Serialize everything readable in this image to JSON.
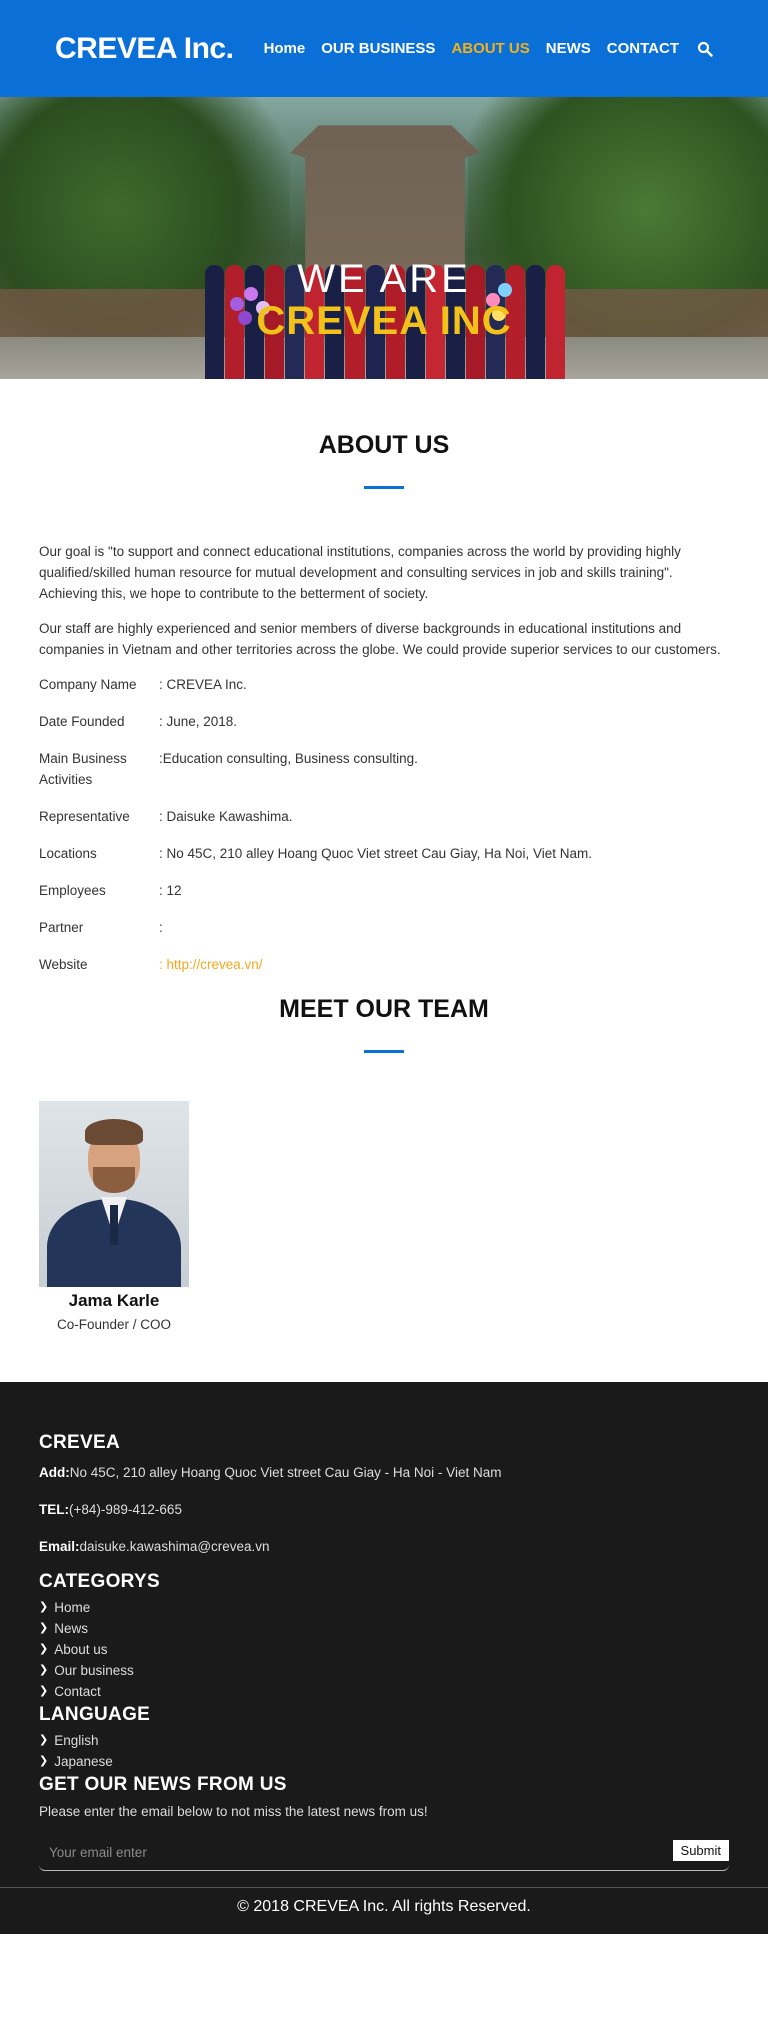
{
  "header": {
    "logo": "CREVEA Inc.",
    "nav": [
      {
        "label": "Home",
        "active": false
      },
      {
        "label": "OUR BUSINESS",
        "active": false
      },
      {
        "label": "ABOUT US",
        "active": true
      },
      {
        "label": "NEWS",
        "active": false
      },
      {
        "label": "CONTACT",
        "active": false
      }
    ],
    "search_icon": "search-icon"
  },
  "hero": {
    "line1": "WE ARE",
    "line2": "CREVEA INC"
  },
  "about": {
    "title": "ABOUT US",
    "paragraphs": [
      "Our goal is \"to support and connect educational institutions, companies across the world by providing highly qualified/skilled human resource for mutual development and consulting services in job and skills training\". Achieving this, we hope to contribute to the betterment of society.",
      "Our staff are highly experienced and senior members of diverse backgrounds in educational institutions and companies in Vietnam and other territories across the globe. We could provide superior services to our customers."
    ],
    "info": [
      {
        "key": "Company Name",
        "value": ": CREVEA Inc."
      },
      {
        "key": "Date Founded",
        "value": ": June, 2018."
      },
      {
        "key": "Main Business Activities",
        "value": ":Education consulting, Business consulting."
      },
      {
        "key": "Representative",
        "value": ": Daisuke Kawashima."
      },
      {
        "key": "Locations",
        "value": ": No 45C, 210 alley Hoang Quoc Viet street Cau Giay, Ha Noi, Viet Nam."
      },
      {
        "key": "Employees",
        "value": ": 12"
      },
      {
        "key": "Partner",
        "value": ":"
      },
      {
        "key": "Website",
        "value": ": http://crevea.vn/"
      }
    ]
  },
  "team": {
    "title": "MEET OUR TEAM",
    "members": [
      {
        "name": "Jama Karle",
        "role": "Co-Founder / COO"
      }
    ]
  },
  "footer": {
    "company_heading": "CREVEA",
    "address_label": "Add:",
    "address": "No 45C, 210 alley Hoang Quoc Viet street Cau Giay - Ha Noi - Viet Nam",
    "tel_label": "TEL:",
    "tel": "(+84)-989-412-665",
    "email_label": "Email:",
    "email": "daisuke.kawashima@crevea.vn",
    "categories_heading": "CATEGORYS",
    "categories": [
      "Home",
      "News",
      "About us",
      "Our business",
      "Contact"
    ],
    "language_heading": "LANGUAGE",
    "languages": [
      "English",
      "Japanese"
    ],
    "news_heading": "GET OUR NEWS FROM US",
    "news_sub": "Please enter the email below to not miss the latest news from us!",
    "email_placeholder": "Your email enter",
    "submit_label": "Submit",
    "copyright": "© 2018 CREVEA Inc. All rights Reserved."
  },
  "colors": {
    "brand_blue": "#0a6fd6",
    "accent_yellow": "#f3b11c",
    "footer_bg": "#1b1a1b"
  }
}
